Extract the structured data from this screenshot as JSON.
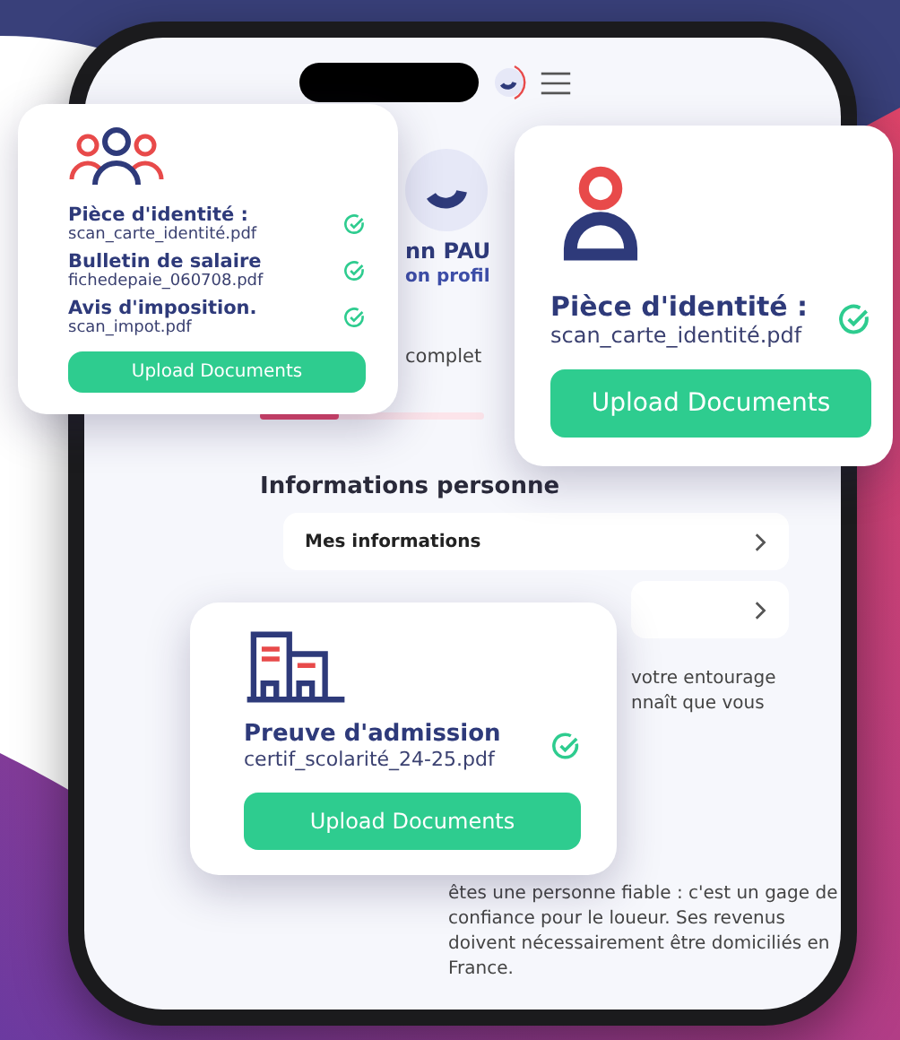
{
  "phone": {
    "profile": {
      "name": "nn PAU",
      "link": "on profil",
      "progress_label": "complet",
      "level": 0.35
    },
    "section_title": "Informations personne",
    "rows": [
      {
        "kind": "titled",
        "label": "Mes informations"
      },
      {
        "kind": "blank"
      }
    ],
    "paragraph": [
      "votre entourage",
      "nnaît que vous",
      "êtes une personne fiable : c'est un gage de",
      "confiance pour le loueur. Ses revenus",
      "doivent nécessairement être domiciliés en",
      "France."
    ]
  },
  "cards": [
    {
      "kind": "group",
      "items": [
        {
          "title": "Pièce d'identité :",
          "file": "scan_carte_identité.pdf",
          "checked": true
        },
        {
          "title": "Bulletin de salaire",
          "file": "fichedepaie_060708.pdf",
          "checked": true
        },
        {
          "title": "Avis d'imposition.",
          "file": "scan_impot.pdf",
          "checked": true
        }
      ],
      "button": "Upload Documents"
    },
    {
      "kind": "person",
      "items": [
        {
          "title": "Pièce d'identité :",
          "file": "scan_carte_identité.pdf",
          "checked": true
        }
      ],
      "button": "Upload Documents"
    },
    {
      "kind": "building",
      "items": [
        {
          "title": "Preuve d'admission",
          "file": "certif_scolarité_24-25.pdf",
          "checked": true
        }
      ],
      "button": "Upload Documents"
    }
  ]
}
